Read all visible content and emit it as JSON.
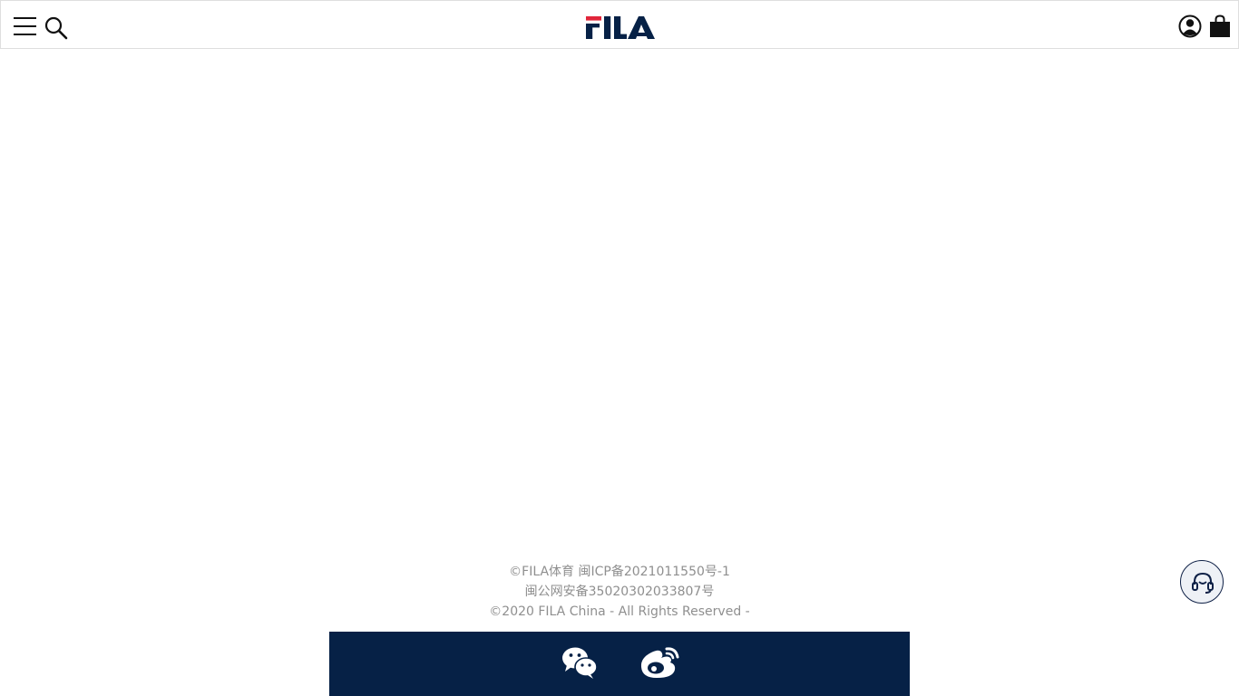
{
  "header": {
    "brand": "FILA",
    "icons": {
      "menu": "hamburger-menu-icon",
      "search": "search-icon",
      "account": "user-account-icon",
      "cart": "shopping-bag-icon"
    }
  },
  "footer": {
    "line1": "©FILA体育 闽ICP备2021011550号-1",
    "line2": "闽公网安备35020302033807号",
    "line3": "©2020 FILA China - All Rights Reserved -"
  },
  "social": {
    "icons": [
      "wechat-icon",
      "weibo-icon"
    ]
  },
  "floating": {
    "icon": "customer-service-headset-icon"
  },
  "colors": {
    "brand_navy": "#062146",
    "brand_red": "#e1253a",
    "footer_text": "#8f8f8f",
    "header_border": "#dedede"
  }
}
